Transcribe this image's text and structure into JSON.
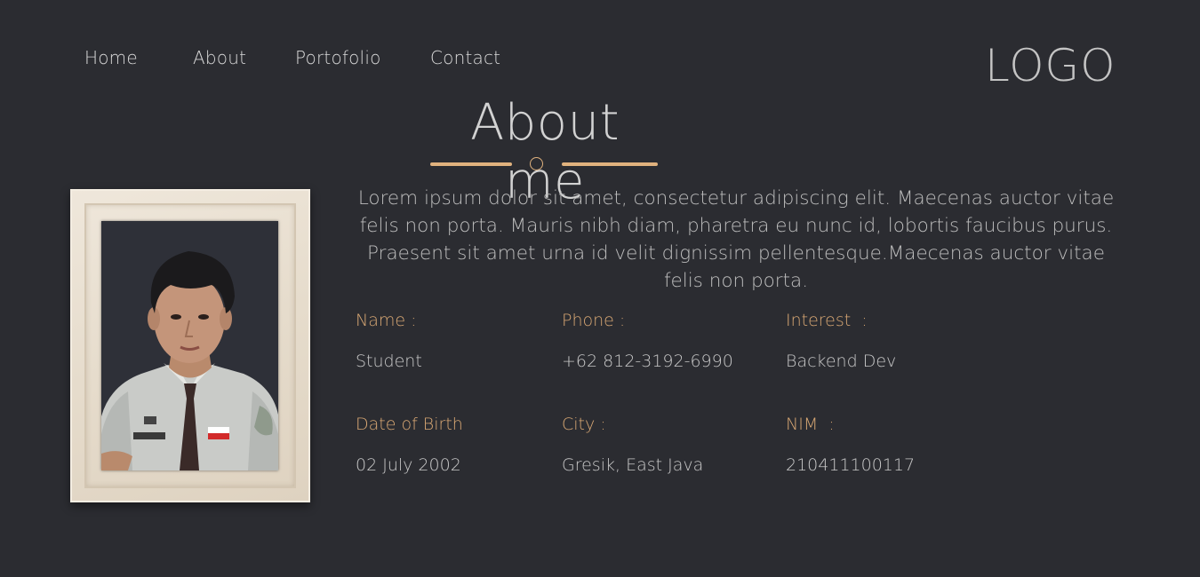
{
  "nav": {
    "items": [
      {
        "label": "Home"
      },
      {
        "label": "About"
      },
      {
        "label": "Portofolio"
      },
      {
        "label": "Contact"
      }
    ]
  },
  "logo": "LOGO",
  "section": {
    "title": "About me",
    "description": "Lorem ipsum dolor sit amet, consectetur adipiscing elit. Maecenas auctor vitae felis non porta. Mauris nibh diam, pharetra eu nunc id, lobortis faucibus purus. Praesent sit amet urna id velit dignissim pellentesque.Maecenas auctor vitae felis non porta."
  },
  "details": {
    "name": {
      "label": "Name :",
      "value": "Student"
    },
    "phone": {
      "label": "Phone :",
      "value": "+62 812-3192-6990"
    },
    "interest": {
      "label": "Interest  :",
      "value": "Backend Dev"
    },
    "dob": {
      "label": "Date of Birth",
      "value": "02 July 2002"
    },
    "city": {
      "label": "City :",
      "value": "Gresik, East Java"
    },
    "nim": {
      "label": "NIM  :",
      "value": "210411100117"
    }
  },
  "colors": {
    "background": "#2b2c31",
    "accent": "#e0b27e",
    "label": "#d9a874",
    "frame": "#e9e0d2"
  },
  "icons": {
    "divider": "circle-ring-icon"
  }
}
